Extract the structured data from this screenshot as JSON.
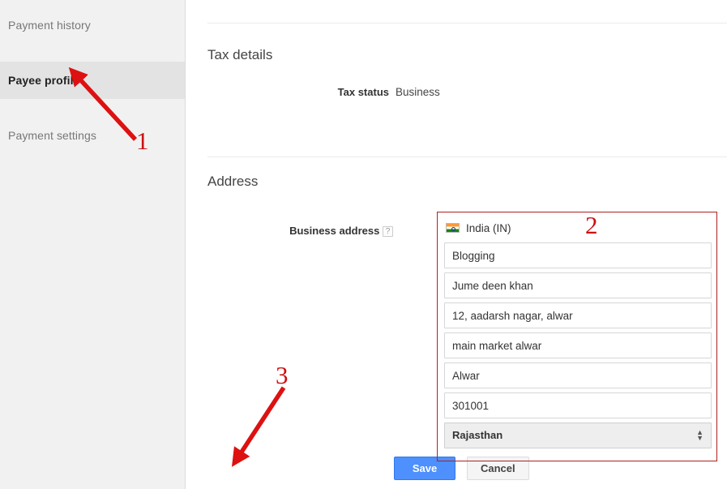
{
  "sidebar": {
    "items": [
      {
        "label": "Payment history",
        "active": false
      },
      {
        "label": "Payee profile",
        "active": true
      },
      {
        "label": "Payment settings",
        "active": false
      }
    ]
  },
  "main": {
    "tax_section": {
      "title": "Tax details",
      "rows": [
        {
          "label": "Tax status",
          "value": "Business"
        }
      ]
    },
    "address_section": {
      "title": "Address",
      "field_label": "Business address",
      "help_icon_glyph": "?",
      "help_icon_name": "help-question-icon",
      "country": {
        "name": "India (IN)",
        "flag_icon_name": "india-flag-icon"
      },
      "fields": [
        {
          "name": "business-name-input",
          "value": "Blogging"
        },
        {
          "name": "recipient-name-input",
          "value": "Jume deen khan"
        },
        {
          "name": "address-line-1-input",
          "value": "12, aadarsh nagar, alwar"
        },
        {
          "name": "address-line-2-input",
          "value": "main market alwar"
        },
        {
          "name": "city-input",
          "value": "Alwar"
        },
        {
          "name": "postal-code-input",
          "value": "301001"
        }
      ],
      "state_select": {
        "name": "state-select",
        "value": "Rajasthan",
        "up_arrow": "▲",
        "down_arrow": "▼"
      }
    },
    "buttons": {
      "save_label": "Save",
      "cancel_label": "Cancel"
    }
  },
  "annotations": {
    "color": "#cc1111",
    "markers": [
      {
        "number": "1",
        "target": "payee-profile-nav-item"
      },
      {
        "number": "2",
        "target": "business-address-group"
      },
      {
        "number": "3",
        "target": "save-button"
      }
    ]
  }
}
